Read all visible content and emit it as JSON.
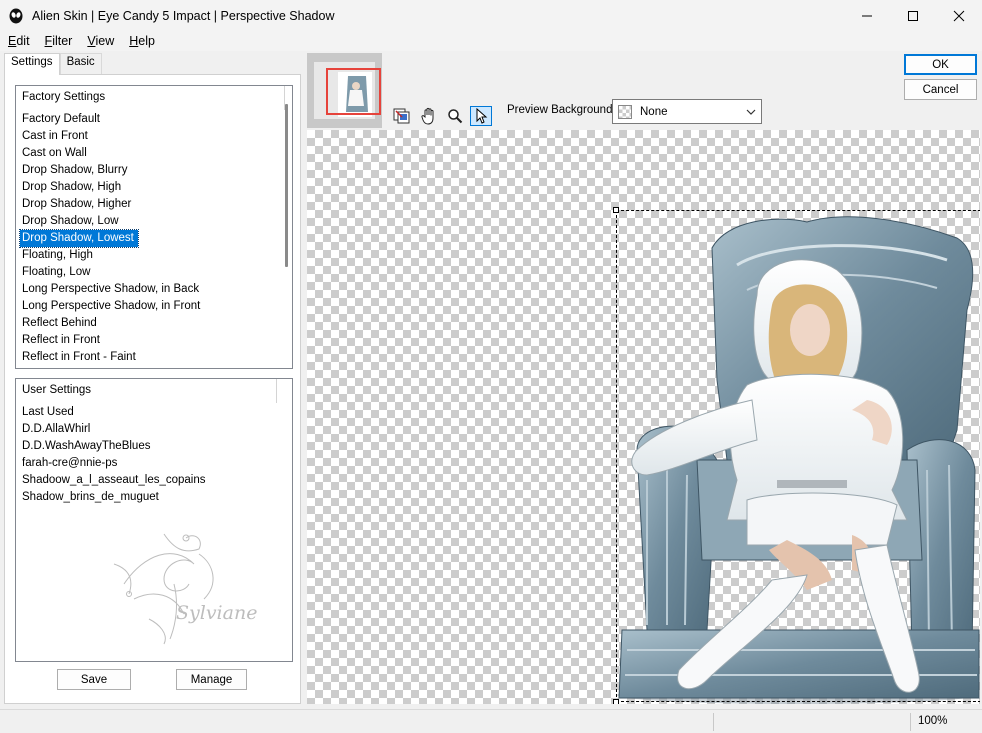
{
  "window": {
    "title": "Alien Skin | Eye Candy 5 Impact | Perspective Shadow"
  },
  "menu": [
    {
      "label": "Edit",
      "accel": "E",
      "rest": "dit"
    },
    {
      "label": "Filter",
      "accel": "F",
      "rest": "ilter"
    },
    {
      "label": "View",
      "accel": "V",
      "rest": "iew"
    },
    {
      "label": "Help",
      "accel": "H",
      "rest": "elp"
    }
  ],
  "tabs": [
    "Settings",
    "Basic"
  ],
  "factory": {
    "header": "Factory Settings",
    "items": [
      "Factory Default",
      "Cast in Front",
      "Cast on Wall",
      "Drop Shadow, Blurry",
      "Drop Shadow, High",
      "Drop Shadow, Higher",
      "Drop Shadow, Low",
      "Drop Shadow, Lowest",
      "Floating, High",
      "Floating, Low",
      "Long Perspective Shadow, in Back",
      "Long Perspective Shadow, in Front",
      "Reflect Behind",
      "Reflect in Front",
      "Reflect in Front - Faint"
    ],
    "selected": "Drop Shadow, Lowest"
  },
  "user": {
    "header": "User Settings",
    "items": [
      "Last Used",
      "D.D.AllaWhirl",
      "D.D.WashAwayTheBlues",
      "farah-cre@nnie-ps",
      "Shadoow_a_l_asseaut_les_copains",
      "Shadow_brins_de_muguet"
    ]
  },
  "watermark_text": "Sylviane",
  "buttons": {
    "save": "Save",
    "manage": "Manage",
    "ok": "OK",
    "cancel": "Cancel"
  },
  "preview_background": {
    "label": "Preview Background:",
    "value": "None"
  },
  "status": {
    "zoom": "100%"
  },
  "colors": {
    "selection": "#0078d7",
    "nav_frame": "#e6433b",
    "throne": "#7e9aaa"
  }
}
